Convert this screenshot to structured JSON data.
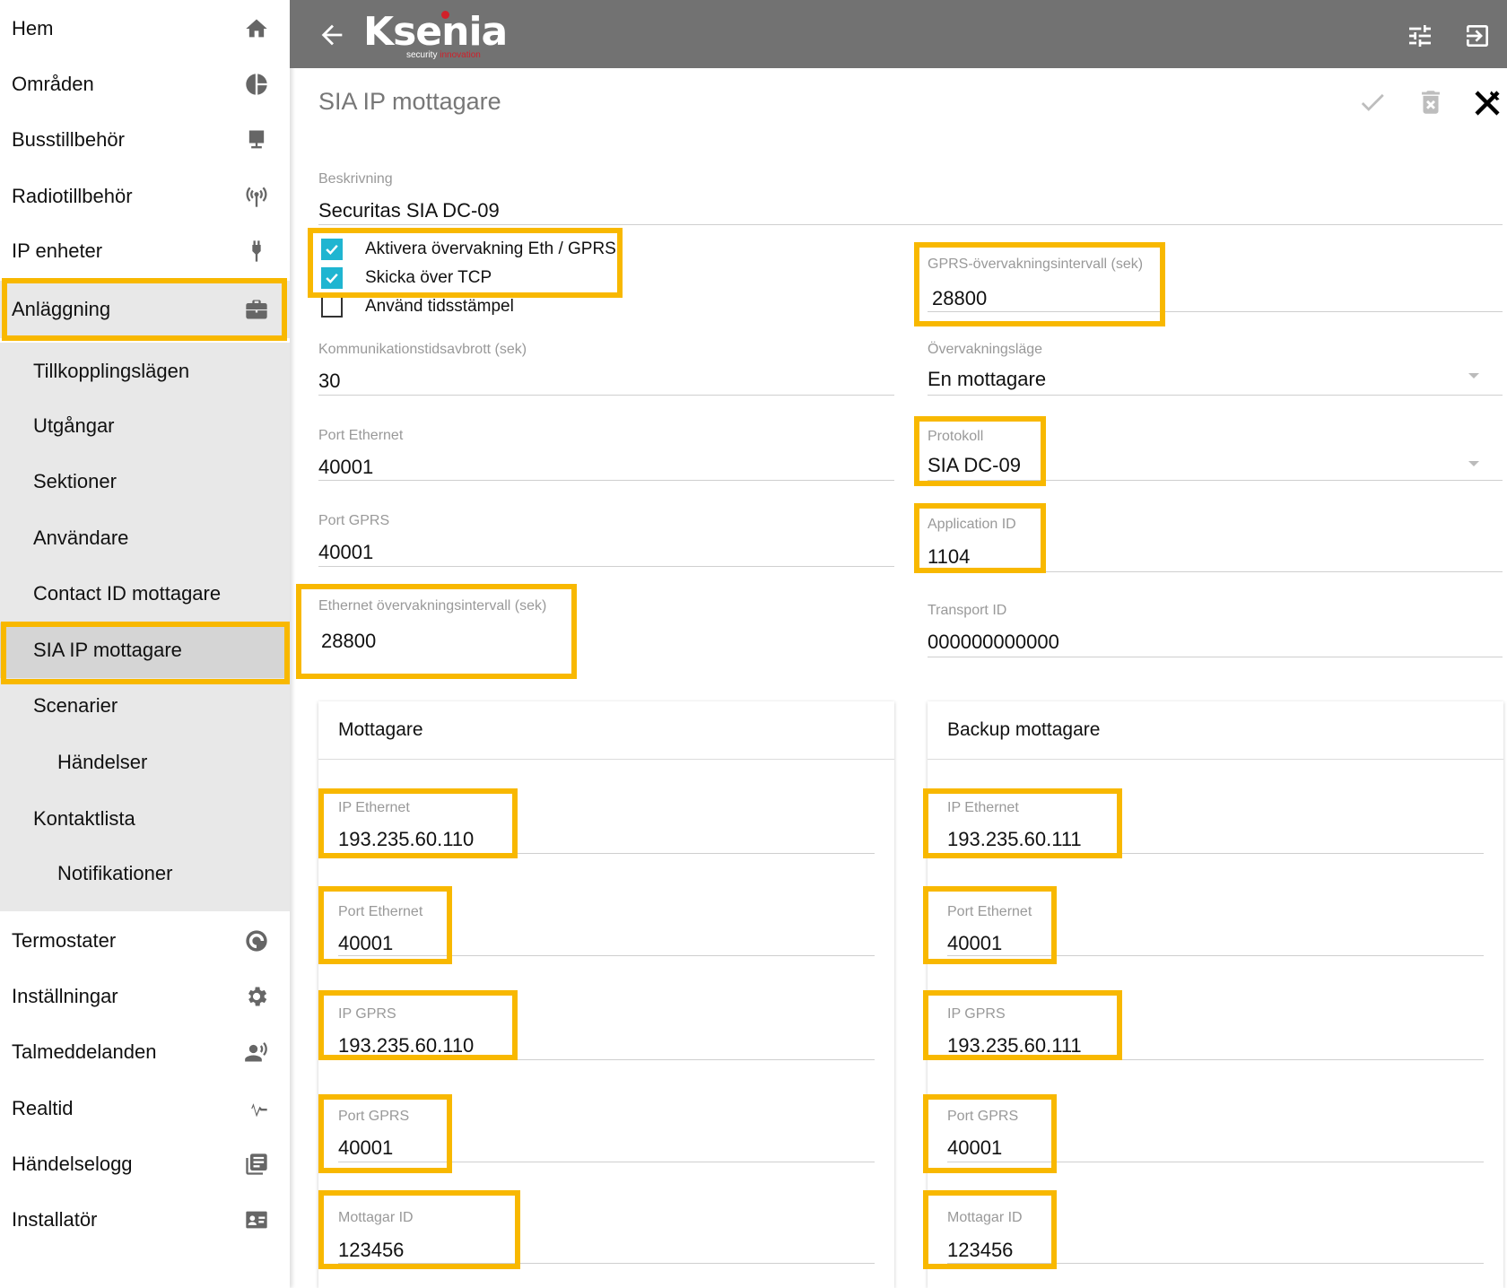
{
  "sidebar": {
    "top_items": [
      {
        "label": "Hem",
        "icon": "home-icon"
      },
      {
        "label": "Områden",
        "icon": "pie-chart-icon"
      },
      {
        "label": "Busstillbehör",
        "icon": "monitor-icon"
      },
      {
        "label": "Radiotillbehör",
        "icon": "radio-signal-icon"
      },
      {
        "label": "IP enheter",
        "icon": "plug-icon"
      },
      {
        "label": "Anläggning",
        "icon": "briefcase-icon"
      }
    ],
    "sub_items": [
      {
        "label": "Tillkopplingslägen"
      },
      {
        "label": "Utgångar"
      },
      {
        "label": "Sektioner"
      },
      {
        "label": "Användare"
      },
      {
        "label": "Contact ID mottagare"
      },
      {
        "label": "SIA IP mottagare"
      },
      {
        "label": "Scenarier"
      },
      {
        "label": "Händelser"
      },
      {
        "label": "Kontaktlista"
      },
      {
        "label": "Notifikationer"
      }
    ],
    "bottom_items": [
      {
        "label": "Termostater",
        "icon": "thermostat-icon"
      },
      {
        "label": "Inställningar",
        "icon": "gear-icon"
      },
      {
        "label": "Talmeddelanden",
        "icon": "voice-icon"
      },
      {
        "label": "Realtid",
        "icon": "pulse-icon"
      },
      {
        "label": "Händelselogg",
        "icon": "log-icon"
      },
      {
        "label": "Installatör",
        "icon": "id-card-icon"
      }
    ]
  },
  "header": {
    "brand": "Ksenia",
    "tagline_a": "security",
    "tagline_b": "innovation"
  },
  "page": {
    "title": "SIA IP mottagare"
  },
  "form": {
    "description": {
      "label": "Beskrivning",
      "value": "Securitas SIA DC-09"
    },
    "checkboxes": [
      {
        "label": "Aktivera övervakning Eth / GPRS",
        "checked": true
      },
      {
        "label": "Skicka över TCP",
        "checked": true
      },
      {
        "label": "Använd tidsstämpel",
        "checked": false
      }
    ],
    "gprs_interval": {
      "label": "GPRS-övervakningsintervall (sek)",
      "value": "28800"
    },
    "comm_timeout": {
      "label": "Kommunikationstidsavbrott (sek)",
      "value": "30"
    },
    "monitoring_mode": {
      "label": "Övervakningsläge",
      "value": "En mottagare"
    },
    "port_ethernet": {
      "label": "Port Ethernet",
      "value": "40001"
    },
    "protocol": {
      "label": "Protokoll",
      "value": "SIA DC-09"
    },
    "port_gprs": {
      "label": "Port GPRS",
      "value": "40001"
    },
    "application_id": {
      "label": "Application ID",
      "value": "1104"
    },
    "eth_interval": {
      "label": "Ethernet övervakningsintervall (sek)",
      "value": "28800"
    },
    "transport_id": {
      "label": "Transport ID",
      "value": "000000000000"
    }
  },
  "receiver": {
    "title": "Mottagare",
    "fields": [
      {
        "label": "IP Ethernet",
        "value": "193.235.60.110"
      },
      {
        "label": "Port Ethernet",
        "value": "40001"
      },
      {
        "label": "IP GPRS",
        "value": "193.235.60.110"
      },
      {
        "label": "Port GPRS",
        "value": "40001"
      },
      {
        "label": "Mottagar ID",
        "value": "123456"
      }
    ]
  },
  "backup_receiver": {
    "title": "Backup mottagare",
    "fields": [
      {
        "label": "IP Ethernet",
        "value": "193.235.60.111"
      },
      {
        "label": "Port Ethernet",
        "value": "40001"
      },
      {
        "label": "IP GPRS",
        "value": "193.235.60.111"
      },
      {
        "label": "Port GPRS",
        "value": "40001"
      },
      {
        "label": "Mottagar ID",
        "value": "123456"
      }
    ]
  },
  "colors": {
    "highlight": "#f8b800",
    "checkbox": "#1fb5d1",
    "topbar": "#727272",
    "submenu_bg": "#e8e8e8"
  }
}
